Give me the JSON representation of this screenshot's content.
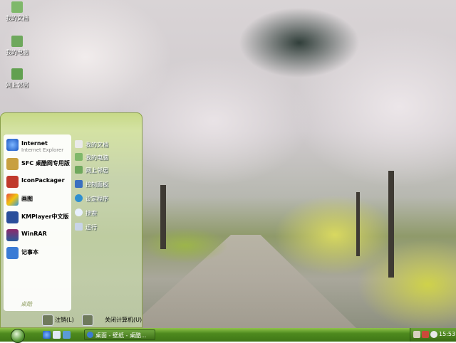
{
  "desktop": {
    "icons": [
      {
        "label": "我的文档",
        "icon": "folder-docs-icon"
      },
      {
        "label": "我的电脑",
        "icon": "computer-icon"
      },
      {
        "label": "网上邻居",
        "icon": "network-icon"
      }
    ]
  },
  "start_menu": {
    "pinned": [
      {
        "label": "Internet",
        "sub": "Internet Explorer",
        "icon": "ie-icon",
        "color": "#2b6fd6"
      },
      {
        "label": "SFC 桌酷网专用版",
        "icon": "sfc-icon",
        "color": "#c8a040"
      },
      {
        "label": "IconPackager",
        "icon": "iconpackager-icon",
        "color": "#c0392b"
      },
      {
        "label": "画图",
        "icon": "paint-icon",
        "color": "#d9a628"
      },
      {
        "label": "KMPlayer中文版",
        "icon": "kmplayer-icon",
        "color": "#2a4e9b"
      },
      {
        "label": "WinRAR",
        "icon": "winrar-icon",
        "color": "#8e2a6b"
      },
      {
        "label": "记事本",
        "icon": "notepad-icon",
        "color": "#3a7bd5"
      }
    ],
    "places": [
      {
        "label": "我的文档",
        "icon": "folder-docs-icon"
      },
      {
        "label": "我的电脑",
        "icon": "computer-icon"
      },
      {
        "label": "网上邻居",
        "icon": "network-icon"
      },
      {
        "label": "控制面板",
        "icon": "control-panel-icon"
      },
      {
        "label": "设定程序",
        "icon": "programs-icon"
      },
      {
        "label": "搜索",
        "icon": "search-icon"
      },
      {
        "label": "运行",
        "icon": "run-icon"
      }
    ],
    "logo_text": "桌酷",
    "logoff_label": "注销(L)",
    "shutdown_label": "关闭计算机(U)"
  },
  "taskbar": {
    "window_title": "桌面 - 壁纸 - 桌酷...",
    "clock": "15:53"
  }
}
